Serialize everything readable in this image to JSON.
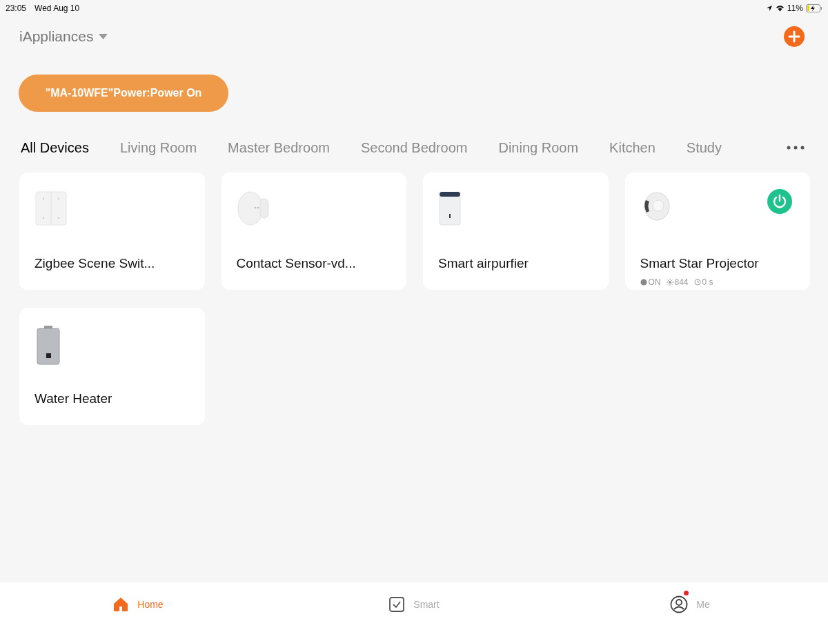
{
  "status_bar": {
    "time": "23:05",
    "date": "Wed Aug 10",
    "battery": "11%"
  },
  "home": {
    "title": "iAppliances"
  },
  "scene_banner": {
    "label": "\"MA-10WFE\"Power:Power On"
  },
  "tabs": [
    {
      "label": "All Devices",
      "selected": true
    },
    {
      "label": "Living Room",
      "selected": false
    },
    {
      "label": "Master Bedroom",
      "selected": false
    },
    {
      "label": "Second Bedroom",
      "selected": false
    },
    {
      "label": "Dining Room",
      "selected": false
    },
    {
      "label": "Kitchen",
      "selected": false
    },
    {
      "label": "Study",
      "selected": false
    }
  ],
  "devices": [
    {
      "kind": "switch",
      "name": "Zigbee Scene Swit...",
      "power_button": false
    },
    {
      "kind": "sensor",
      "name": "Contact Sensor-vd...",
      "power_button": false
    },
    {
      "kind": "purifier",
      "name": "Smart airpurfier",
      "power_button": false
    },
    {
      "kind": "projector",
      "name": "Smart Star Projector",
      "power_button": true,
      "stats": [
        {
          "kind": "power",
          "text": "ON"
        },
        {
          "kind": "brightness",
          "text": "844"
        },
        {
          "kind": "timer",
          "text": "0 s"
        }
      ]
    },
    {
      "kind": "heater",
      "name": "Water Heater",
      "power_button": false
    }
  ],
  "nav": [
    {
      "kind": "home",
      "label": "Home",
      "selected": true,
      "badge": false
    },
    {
      "kind": "smart",
      "label": "Smart",
      "selected": false,
      "badge": false
    },
    {
      "kind": "me",
      "label": "Me",
      "selected": false,
      "badge": true
    }
  ]
}
